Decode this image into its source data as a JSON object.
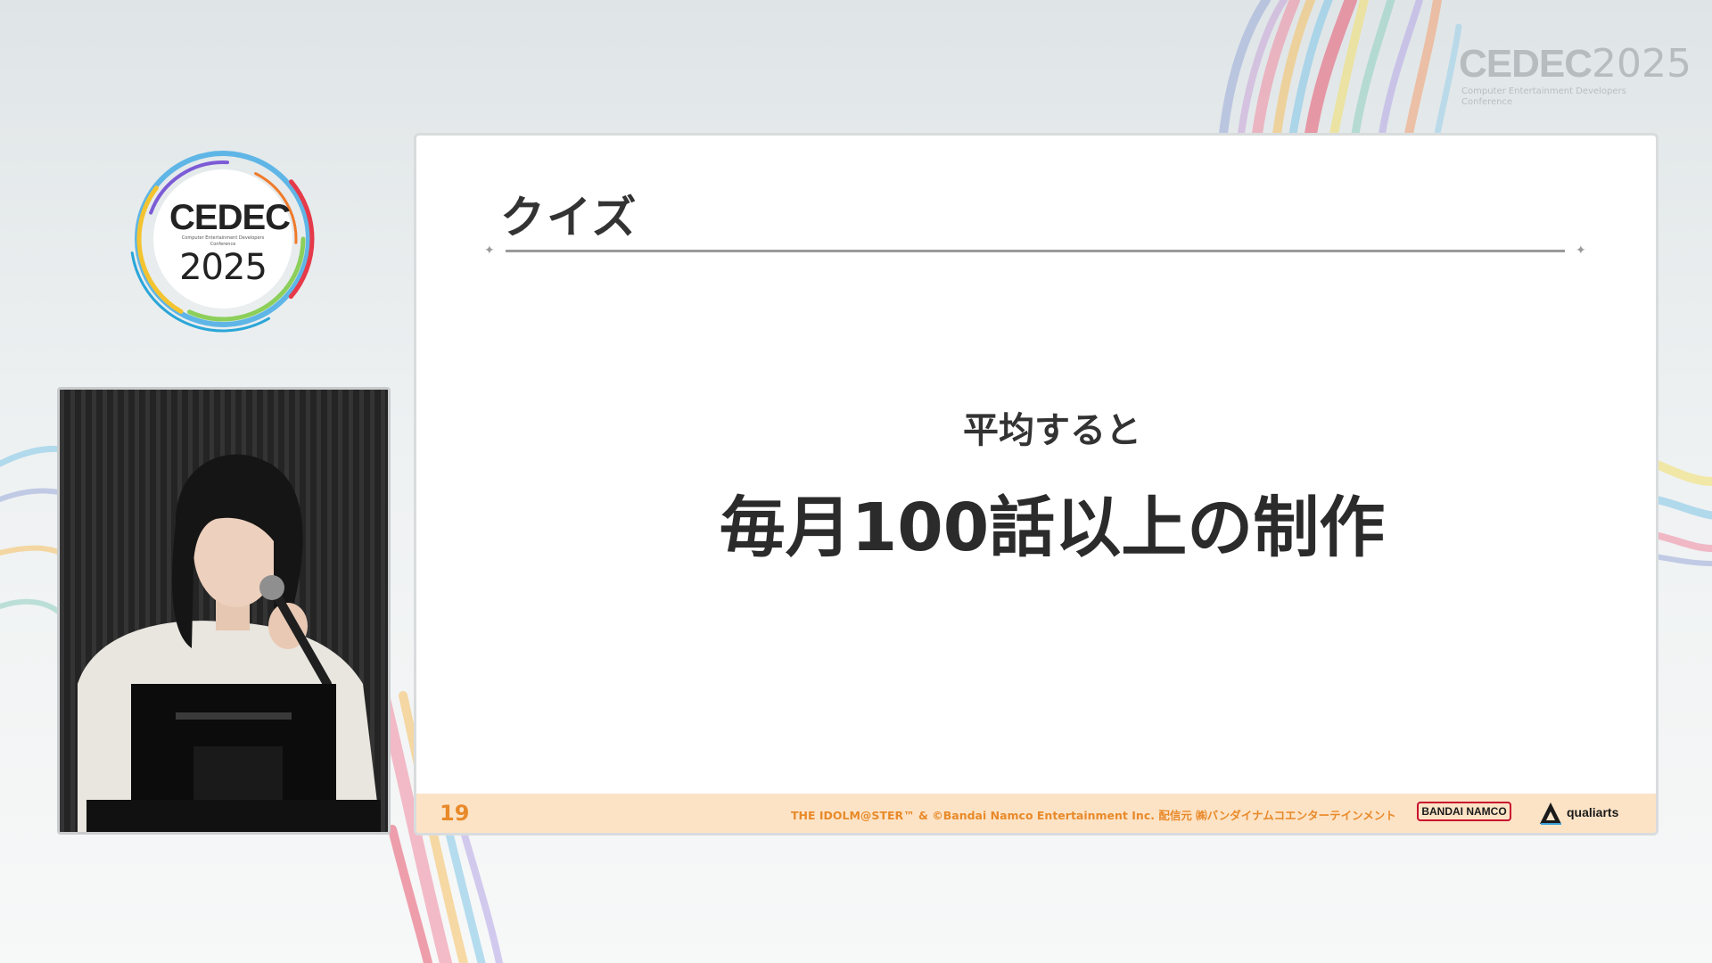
{
  "event_logo": {
    "corner_brand": "CEDEC",
    "corner_year": "2025",
    "corner_subtitle": "Computer Entertainment Developers Conference",
    "round_brand": "CEDEC",
    "round_subtitle": "Computer Entertainment Developers Conference",
    "round_year": "2025"
  },
  "slide": {
    "title": "クイズ",
    "lead": "平均すると",
    "headline": "毎月100話以上の制作",
    "page_number": "19",
    "copyright": "THE IDOLM@STER™ & ©Bandai Namco Entertainment Inc.  配信元 ㈱バンダイナムコエンターテインメント",
    "sponsor_1": "BANDAI NAMCO",
    "sponsor_2": "qualiarts"
  },
  "colors": {
    "footer_bg": "#fce3c6",
    "accent_orange": "#e88a2a",
    "bandai_red": "#c8102e"
  }
}
